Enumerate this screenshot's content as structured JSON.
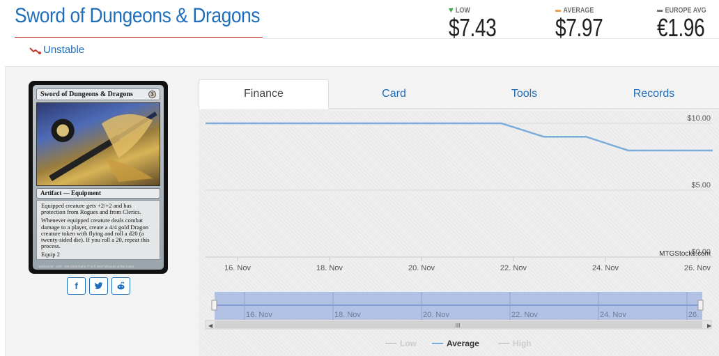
{
  "header": {
    "title": "Sword of Dungeons & Dragons",
    "set_name": "Unstable"
  },
  "prices": [
    {
      "label": "LOW",
      "value": "$7.43",
      "marker_color": "#2eaa3a"
    },
    {
      "label": "AVERAGE",
      "value": "$7.97",
      "marker_color": "#f0a24a"
    },
    {
      "label": "EUROPE AVG",
      "value": "€1.96",
      "marker_color": "#777777"
    }
  ],
  "card": {
    "name": "Sword of Dungeons & Dragons",
    "mana_cost": "3",
    "type_line": "Artifact — Equipment",
    "rules_1": "Equipped creature gets +2/+2 and has protection from Rogues and from Clerics.",
    "rules_2": "Whenever equipped creature deals combat damage to a player, create a 4/4 gold Dragon creature token with flying and roll a d20 (a twenty-sided die). If you roll a 20, repeat this process.",
    "rules_3": "Equip 2",
    "footer": "163/216 M · UST · EN Chris Rahn   ™ & © 2017 Wizards of the Coast"
  },
  "share": {
    "facebook": "f",
    "twitter": "t",
    "reddit": "r"
  },
  "tabs": [
    {
      "label": "Finance",
      "active": true
    },
    {
      "label": "Card",
      "active": false
    },
    {
      "label": "Tools",
      "active": false
    },
    {
      "label": "Records",
      "active": false
    }
  ],
  "chart_credit": "MTGStocks.com",
  "colors": {
    "link": "#1f6ebb",
    "series_average": "#7cacda",
    "navigator_fill": "#9eb3e0"
  },
  "chart_data": {
    "type": "line",
    "x": [
      "15 Nov",
      "16 Nov",
      "17 Nov",
      "18 Nov",
      "19 Nov",
      "20 Nov",
      "21 Nov",
      "22 Nov",
      "23 Nov",
      "24 Nov",
      "25 Nov",
      "26 Nov",
      "26 Nov"
    ],
    "x_ticks": [
      "16. Nov",
      "18. Nov",
      "20. Nov",
      "22. Nov",
      "24. Nov",
      "26. Nov"
    ],
    "y_ticks": [
      "$10.00",
      "$5.00",
      "$0.00"
    ],
    "ylim": [
      0,
      10
    ],
    "series": [
      {
        "name": "Low",
        "visible": false,
        "values": []
      },
      {
        "name": "Average",
        "visible": true,
        "values": [
          10.0,
          10.0,
          10.0,
          10.0,
          10.0,
          10.0,
          10.0,
          10.0,
          9.0,
          9.0,
          7.97,
          7.97,
          7.97
        ]
      },
      {
        "name": "High",
        "visible": false,
        "values": []
      }
    ],
    "navigator_ticks": [
      "16. Nov",
      "18. Nov",
      "20. Nov",
      "22. Nov",
      "24. Nov",
      "26."
    ],
    "legend_position": "bottom"
  }
}
